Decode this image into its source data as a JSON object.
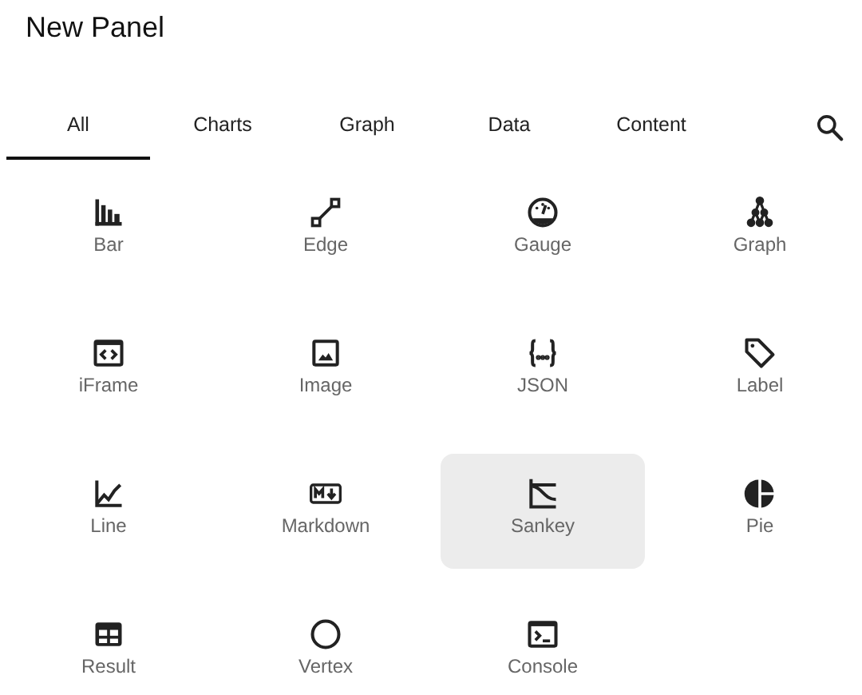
{
  "title": "New Panel",
  "tabs": [
    {
      "label": "All",
      "selected": true
    },
    {
      "label": "Charts",
      "selected": false
    },
    {
      "label": "Graph",
      "selected": false
    },
    {
      "label": "Data",
      "selected": false
    },
    {
      "label": "Content",
      "selected": false
    }
  ],
  "items": [
    {
      "label": "Bar",
      "highlighted": false
    },
    {
      "label": "Edge",
      "highlighted": false
    },
    {
      "label": "Gauge",
      "highlighted": false
    },
    {
      "label": "Graph",
      "highlighted": false
    },
    {
      "label": "iFrame",
      "highlighted": false
    },
    {
      "label": "Image",
      "highlighted": false
    },
    {
      "label": "JSON",
      "highlighted": false
    },
    {
      "label": "Label",
      "highlighted": false
    },
    {
      "label": "Line",
      "highlighted": false
    },
    {
      "label": "Markdown",
      "highlighted": false
    },
    {
      "label": "Sankey",
      "highlighted": true
    },
    {
      "label": "Pie",
      "highlighted": false
    },
    {
      "label": "Result",
      "highlighted": false
    },
    {
      "label": "Vertex",
      "highlighted": false
    },
    {
      "label": "Console",
      "highlighted": false
    }
  ]
}
